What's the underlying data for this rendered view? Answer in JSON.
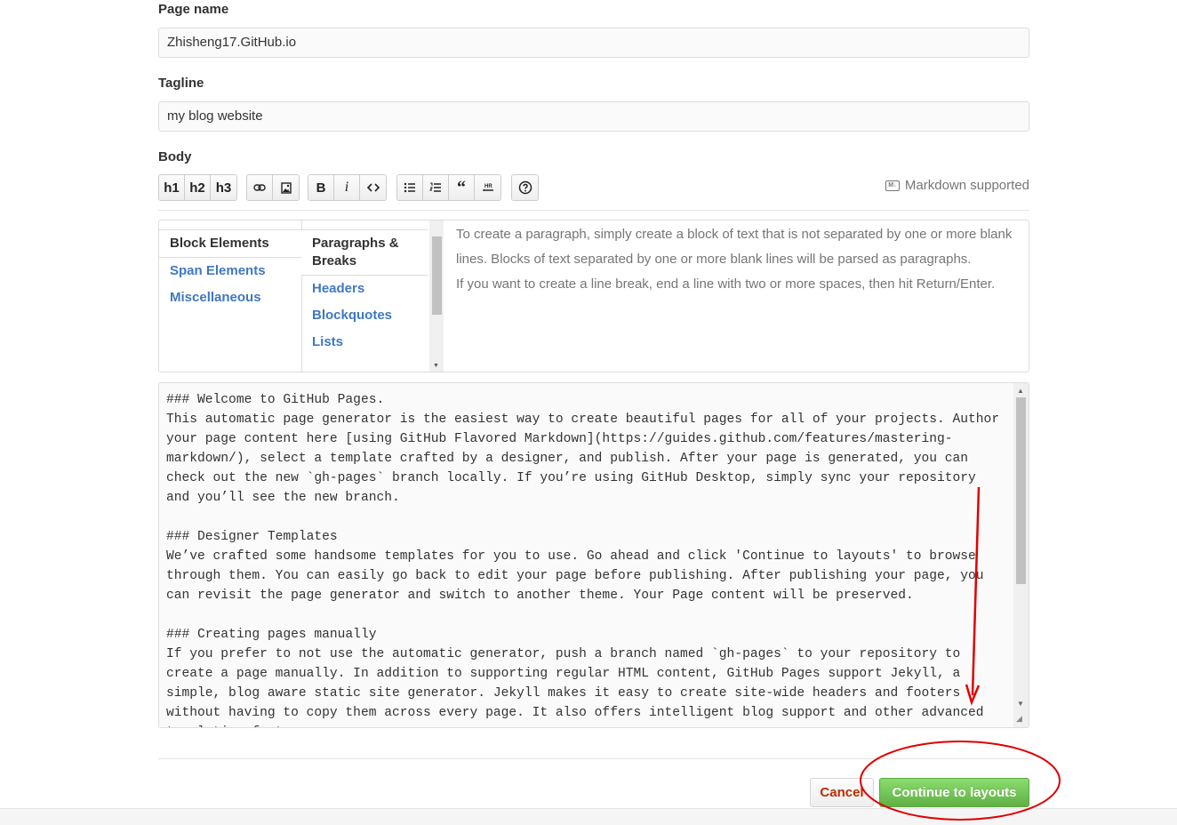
{
  "form": {
    "page_name_label": "Page name",
    "page_name_value": "Zhisheng17.GitHub.io",
    "tagline_label": "Tagline",
    "tagline_value": "my blog website",
    "body_label": "Body"
  },
  "toolbar": {
    "h1": "h1",
    "h2": "h2",
    "h3": "h3",
    "bold": "B",
    "italic": "i",
    "markdown_note": "Markdown supported",
    "markdown_icon": "markdown-icon",
    "icons": [
      "link-icon",
      "image-icon",
      "code-icon",
      "unordered-list-icon",
      "ordered-list-icon",
      "quote-icon",
      "hr-icon",
      "help-icon"
    ]
  },
  "help": {
    "categories": [
      "Block Elements",
      "Span Elements",
      "Miscellaneous"
    ],
    "topics": [
      "Paragraphs & Breaks",
      "Headers",
      "Blockquotes",
      "Lists"
    ],
    "text_p1": "To create a paragraph, simply create a block of text that is not separated by one or more blank lines. Blocks of text separated by one or more blank lines will be parsed as paragraphs.",
    "text_p2": "If you want to create a line break, end a line with two or more spaces, then hit Return/Enter."
  },
  "editor": {
    "content": "### Welcome to GitHub Pages.\nThis automatic page generator is the easiest way to create beautiful pages for all of your projects. Author your page content here [using GitHub Flavored Markdown](https://guides.github.com/features/mastering-markdown/), select a template crafted by a designer, and publish. After your page is generated, you can check out the new `gh-pages` branch locally. If you’re using GitHub Desktop, simply sync your repository and you’ll see the new branch.\n\n### Designer Templates\nWe’ve crafted some handsome templates for you to use. Go ahead and click 'Continue to layouts' to browse through them. You can easily go back to edit your page before publishing. After publishing your page, you can revisit the page generator and switch to another theme. Your Page content will be preserved.\n\n### Creating pages manually\nIf you prefer to not use the automatic generator, push a branch named `gh-pages` to your repository to create a page manually. In addition to supporting regular HTML content, GitHub Pages support Jekyll, a simple, blog aware static site generator. Jekyll makes it easy to create site-wide headers and footers without having to copy them across every page. It also offers intelligent blog support and other advanced templating features."
  },
  "actions": {
    "cancel": "Cancel",
    "continue": "Continue to layouts"
  },
  "colors": {
    "annotation": "#e00000",
    "continue_button": "#60b044",
    "link": "#4078c0"
  }
}
